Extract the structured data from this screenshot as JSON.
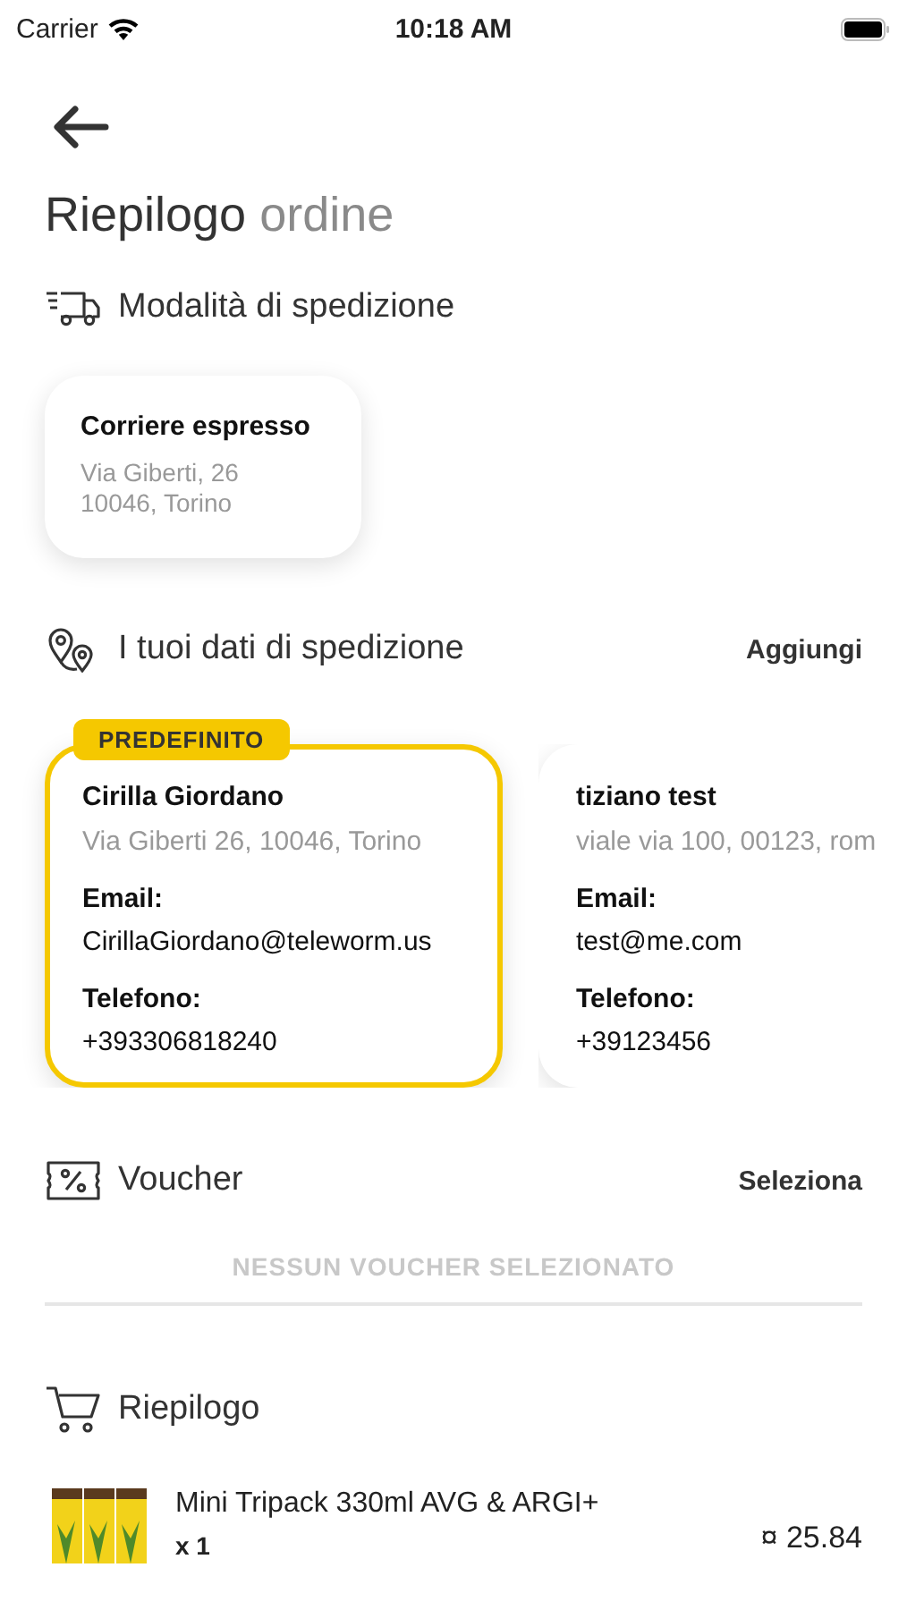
{
  "status_bar": {
    "carrier": "Carrier",
    "time": "10:18 AM"
  },
  "title": {
    "main": "Riepilogo",
    "secondary": "ordine"
  },
  "shipping_method": {
    "heading": "Modalità di spedizione",
    "options": [
      {
        "name": "Corriere espresso",
        "address_lines": [
          "Via Giberti, 26",
          "10046, Torino"
        ]
      }
    ]
  },
  "shipping_data": {
    "heading": "I tuoi dati di spedizione",
    "action": "Aggiungi",
    "addresses": [
      {
        "selected": true,
        "badge": "PREDEFINITO",
        "name": "Cirilla Giordano",
        "address": "Via Giberti 26, 10046, Torino",
        "email_label": "Email:",
        "email": "CirillaGiordano@teleworm.us",
        "phone_label": "Telefono:",
        "phone": "+393306818240"
      },
      {
        "selected": false,
        "name": "tiziano test",
        "address": "viale via 100, 00123, rom",
        "email_label": "Email:",
        "email": "test@me.com",
        "phone_label": "Telefono:",
        "phone": "+39123456"
      }
    ]
  },
  "voucher": {
    "heading": "Voucher",
    "action": "Seleziona",
    "empty_message": "NESSUN VOUCHER SELEZIONATO"
  },
  "summary": {
    "heading": "Riepilogo",
    "items": [
      {
        "name": "Mini Tripack 330ml AVG & ARGI+",
        "quantity": "x 1",
        "price": "¤ 25.84"
      }
    ]
  }
}
